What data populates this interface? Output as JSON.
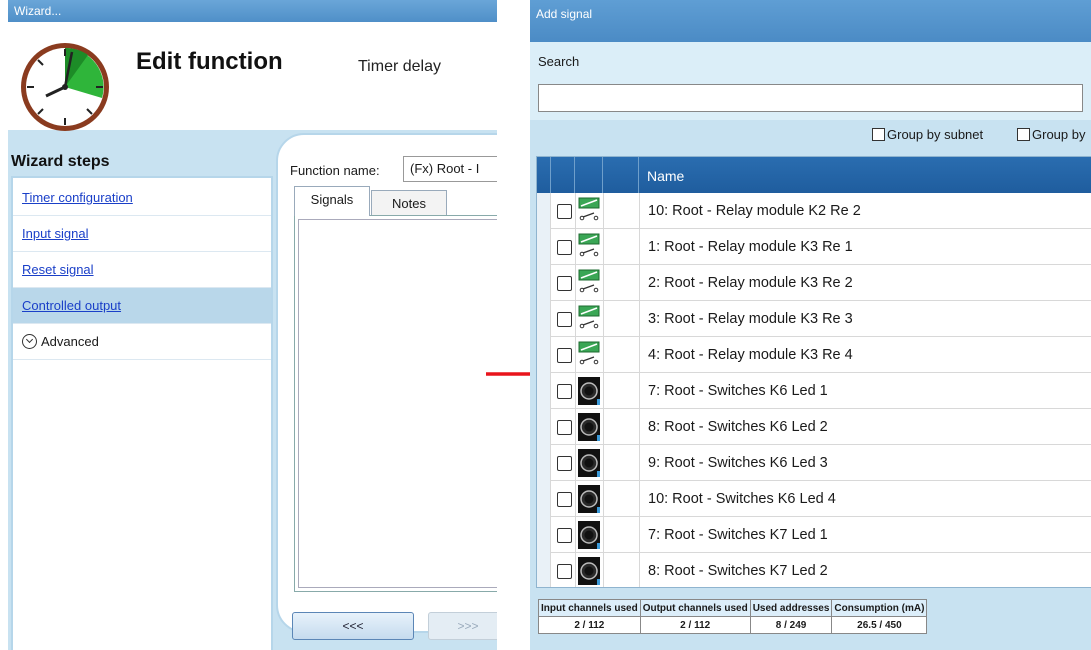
{
  "wizard": {
    "window_title": "Wizard...",
    "title": "Edit function",
    "subtitle": "Timer delay",
    "steps_heading": "Wizard steps",
    "steps": [
      {
        "label": "Timer configuration"
      },
      {
        "label": "Input signal"
      },
      {
        "label": "Reset signal"
      },
      {
        "label": "Controlled output"
      }
    ],
    "advanced_label": "Advanced",
    "function_name_label": "Function name:",
    "function_name_value": "(Fx) Root - I",
    "tabs": [
      "Signals",
      "Notes"
    ],
    "prev_button": "<<<",
    "next_button": ">>>"
  },
  "add_signal": {
    "window_title": "Add signal",
    "search_label": "Search",
    "search_value": "",
    "group_by_subnet": "Group by subnet",
    "group_by_other": "Group by",
    "column_name": "Name",
    "rows": [
      {
        "name": "10: Root - Relay module K2 Re 2",
        "icon": "relay-icon"
      },
      {
        "name": "1: Root - Relay module K3 Re 1",
        "icon": "relay-icon"
      },
      {
        "name": "2: Root - Relay module K3 Re 2",
        "icon": "relay-icon"
      },
      {
        "name": "3: Root - Relay module K3 Re 3",
        "icon": "relay-icon"
      },
      {
        "name": "4: Root - Relay module K3 Re 4",
        "icon": "relay-icon"
      },
      {
        "name": "7: Root - Switches K6 Led 1",
        "icon": "switch-led-icon"
      },
      {
        "name": "8: Root - Switches K6 Led 2",
        "icon": "switch-led-icon"
      },
      {
        "name": "9: Root - Switches K6 Led 3",
        "icon": "switch-led-icon"
      },
      {
        "name": "10: Root - Switches K6 Led 4",
        "icon": "switch-led-icon"
      },
      {
        "name": "7: Root - Switches K7 Led 1",
        "icon": "switch-led-icon"
      },
      {
        "name": "8: Root - Switches K7 Led 2",
        "icon": "switch-led-icon"
      }
    ],
    "stats": {
      "headers": [
        "Input channels used",
        "Output channels used",
        "Used addresses",
        "Consumption (mA)"
      ],
      "values": [
        "2 / 112",
        "2 / 112",
        "8 / 249",
        "26.5 / 450"
      ]
    }
  },
  "colors": {
    "accent": "#2a6db0",
    "panel": "#c8e2f1",
    "link": "#1a3fc8",
    "arrow": "#e8141c"
  }
}
